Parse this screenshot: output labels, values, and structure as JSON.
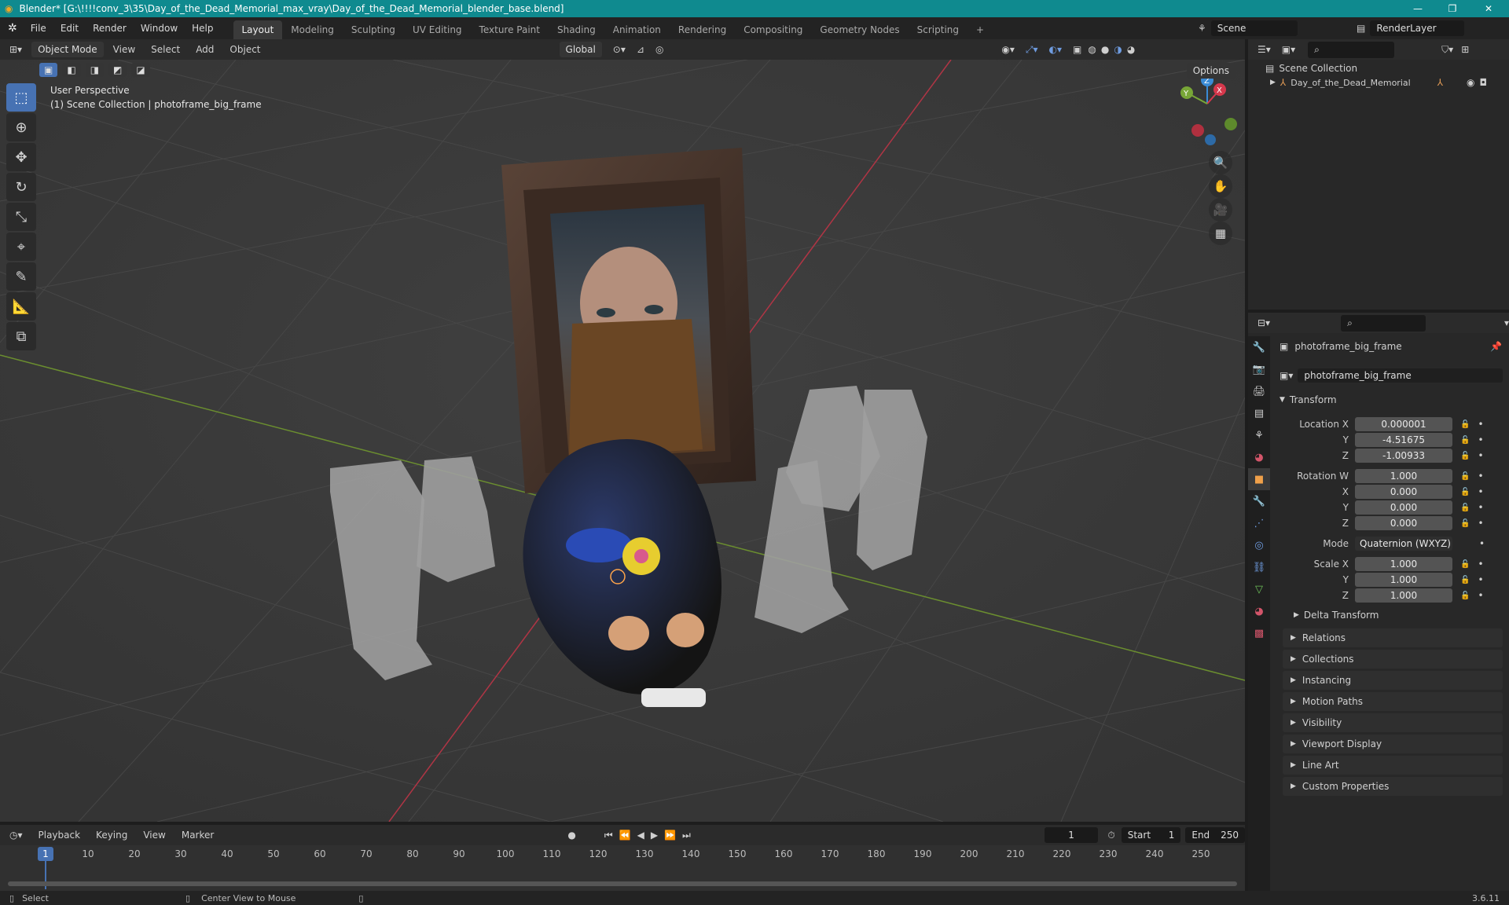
{
  "window": {
    "title": "Blender* [G:\\!!!!conv_3\\35\\Day_of_the_Dead_Memorial_max_vray\\Day_of_the_Dead_Memorial_blender_base.blend]",
    "minimize": "—",
    "restore": "❐",
    "close": "✕"
  },
  "menu": [
    "File",
    "Edit",
    "Render",
    "Window",
    "Help"
  ],
  "workspaces": [
    "Layout",
    "Modeling",
    "Sculpting",
    "UV Editing",
    "Texture Paint",
    "Shading",
    "Animation",
    "Rendering",
    "Compositing",
    "Geometry Nodes",
    "Scripting",
    "+"
  ],
  "scene": {
    "name": "Scene",
    "render_layer": "RenderLayer"
  },
  "viewport_header": {
    "mode": "Object Mode",
    "menus": [
      "View",
      "Select",
      "Add",
      "Object"
    ],
    "orientation": "Global",
    "options": "Options"
  },
  "viewport": {
    "perspective": "User Perspective",
    "collection": "(1) Scene Collection | photoframe_big_frame",
    "gizmo": {
      "x": "X",
      "y": "Y",
      "z": "Z"
    }
  },
  "outliner": {
    "root": "Scene Collection",
    "item": "Day_of_the_Dead_Memorial"
  },
  "properties": {
    "object_name": "photoframe_big_frame",
    "data_name": "photoframe_big_frame",
    "transform_title": "Transform",
    "location": {
      "label": "Location X",
      "x": "0.000001",
      "y": "-4.51675",
      "z": "-1.00933"
    },
    "rotation": {
      "label": "Rotation W",
      "w": "1.000",
      "x": "0.000",
      "y": "0.000",
      "z": "0.000"
    },
    "mode": {
      "label": "Mode",
      "value": "Quaternion (WXYZ)"
    },
    "scale": {
      "label": "Scale X",
      "x": "1.000",
      "y": "1.000",
      "z": "1.000"
    },
    "axis": {
      "y": "Y",
      "z": "Z",
      "x": "X"
    },
    "delta": "Delta Transform",
    "sections": [
      "Relations",
      "Collections",
      "Instancing",
      "Motion Paths",
      "Visibility",
      "Viewport Display",
      "Line Art",
      "Custom Properties"
    ]
  },
  "timeline": {
    "menus": [
      "Playback",
      "Keying",
      "View",
      "Marker"
    ],
    "current_frame": "1",
    "start_label": "Start",
    "start": "1",
    "end_label": "End",
    "end": "250",
    "ticks": [
      "10",
      "20",
      "30",
      "40",
      "50",
      "60",
      "70",
      "80",
      "90",
      "100",
      "110",
      "120",
      "130",
      "140",
      "150",
      "160",
      "170",
      "180",
      "190",
      "200",
      "210",
      "220",
      "230",
      "240",
      "250"
    ]
  },
  "status": {
    "select": "Select",
    "center": "Center View to Mouse",
    "version": "3.6.11"
  },
  "colors": {
    "accent": "#4772b3",
    "titlebar": "#0f8a8f",
    "x_axis": "#d6384c",
    "y_axis": "#78a637",
    "z_axis": "#3a8bd6"
  }
}
